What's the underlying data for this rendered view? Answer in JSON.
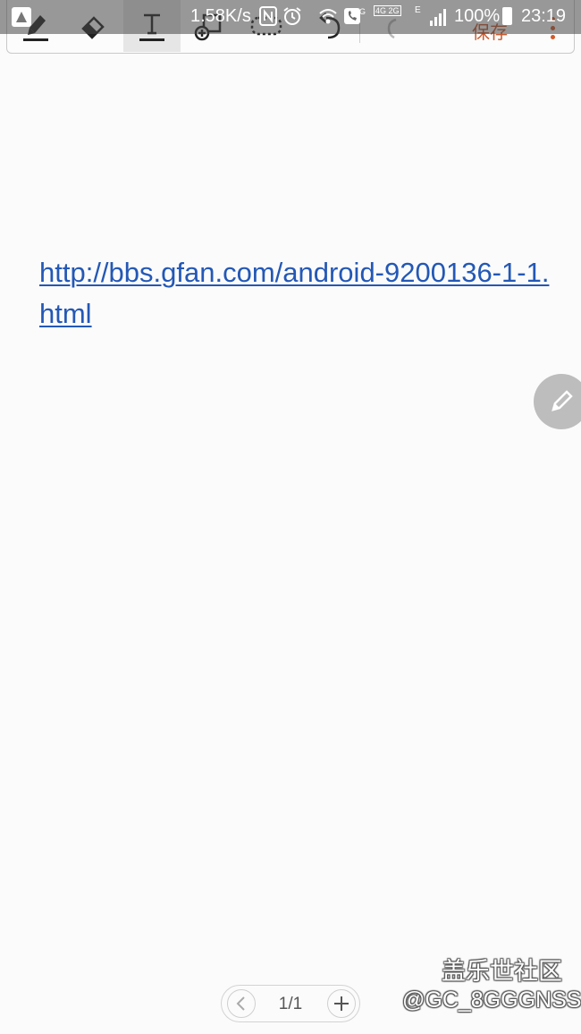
{
  "status_bar": {
    "speed": "1.58K/s",
    "net_label_1": "4G",
    "net_label_2": "4G 2G",
    "net_label_3": "E",
    "battery": "100%",
    "time": "23:19"
  },
  "toolbar": {
    "tools": [
      "pen-tool",
      "eraser-tool",
      "text-tool",
      "insert-tool",
      "selection-tool",
      "undo-tool",
      "redo-tool"
    ],
    "active_tool": "text-tool",
    "save_label": "保存"
  },
  "note": {
    "link_text": "http://bbs.gfan.com/android-9200136-1-1.html"
  },
  "pager": {
    "count": "1/1"
  },
  "watermark": {
    "title": "盖乐世社区",
    "handle": "@GC_8GGGNSS"
  },
  "colors": {
    "link": "#2358b6",
    "save": "#c8582c",
    "background": "#fbfbfb"
  }
}
